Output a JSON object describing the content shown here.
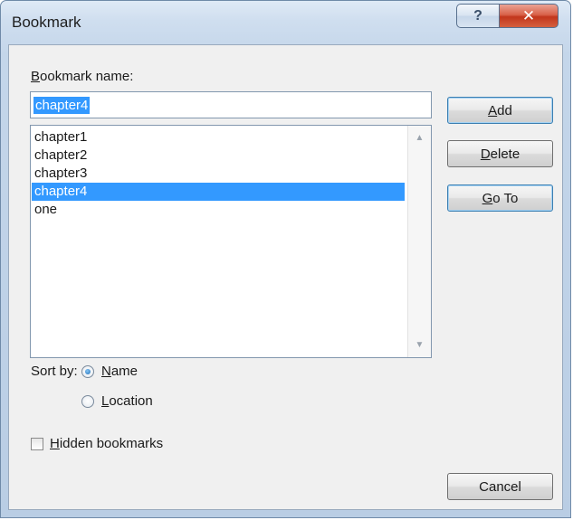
{
  "window": {
    "title": "Bookmark",
    "help_glyph": "?",
    "close_glyph": "✕"
  },
  "form": {
    "name_label_accel": "B",
    "name_label_rest": "ookmark name:",
    "name_value": "chapter4"
  },
  "bookmarks": [
    {
      "label": "chapter1",
      "selected": false
    },
    {
      "label": "chapter2",
      "selected": false
    },
    {
      "label": "chapter3",
      "selected": false
    },
    {
      "label": "chapter4",
      "selected": true
    },
    {
      "label": "one",
      "selected": false
    }
  ],
  "buttons": {
    "add": {
      "accel": "A",
      "rest": "dd"
    },
    "delete": {
      "accel": "D",
      "rest": "elete"
    },
    "goto": {
      "accel": "G",
      "rest": "o To"
    },
    "cancel": "Cancel"
  },
  "sort": {
    "label": "Sort by:",
    "name": {
      "accel": "N",
      "rest": "ame",
      "checked": true
    },
    "location": {
      "accel": "L",
      "rest": "ocation",
      "checked": false
    }
  },
  "hidden": {
    "accel": "H",
    "rest": "idden bookmarks",
    "checked": false
  },
  "colors": {
    "selection": "#3399ff",
    "dialog_bg": "#f0f0f0",
    "close_button": "#c2361c"
  },
  "icons": {
    "help": "help-icon",
    "close": "close-icon",
    "scroll_up": "scroll-up-arrow-icon",
    "scroll_down": "scroll-down-arrow-icon"
  }
}
